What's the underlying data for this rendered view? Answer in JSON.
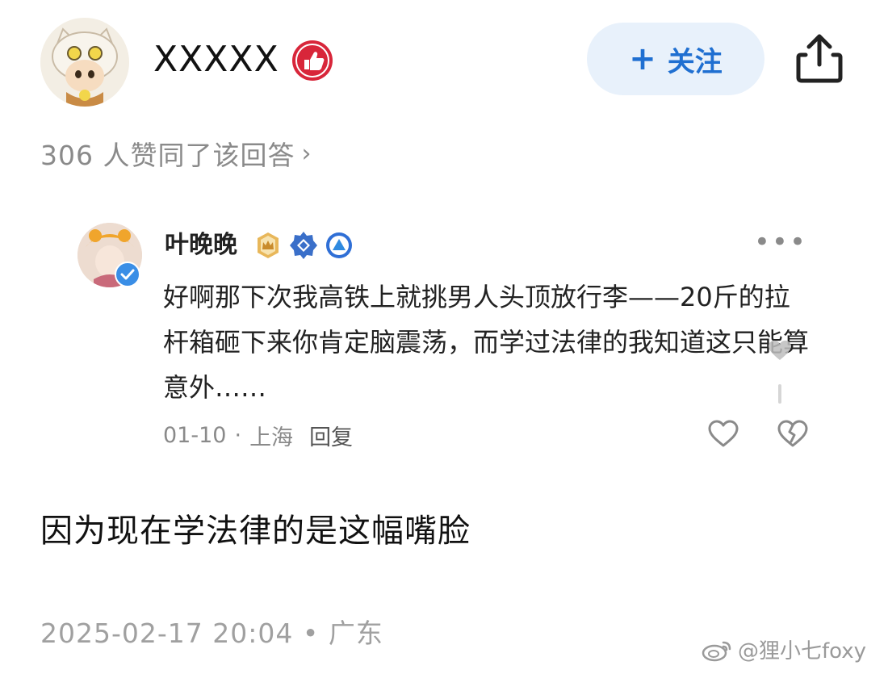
{
  "author": {
    "name": "XXXXX",
    "avatar_icon": "cat-girl-avatar",
    "badge_icon": "thumbs-up-badge-icon"
  },
  "follow_button": {
    "plus": "+",
    "label": "关注"
  },
  "agree_line": {
    "text": "306 人赞同了该回答",
    "chevron": "›"
  },
  "comment": {
    "name": "叶晚晚",
    "text": "好啊那下次我高铁上就挑男人头顶放行李——20斤的拉杆箱砸下来你肯定脑震荡，而学过法律的我知道这只能算意外……",
    "date": "01-10",
    "separator": "·",
    "location": "上海",
    "reply_label": "回复",
    "more": "•••"
  },
  "answer": {
    "text": "因为现在学法律的是这幅嘴脸"
  },
  "footer": {
    "timestamp": "2025-02-17 20:04 • 广东"
  },
  "watermark": {
    "text": "@狸小七foxy"
  },
  "colors": {
    "accent_blue": "#1f6fd1",
    "follow_bg": "#e8f1fb",
    "badge_red": "#d8263a",
    "muted_gray": "#8a8a8a"
  }
}
